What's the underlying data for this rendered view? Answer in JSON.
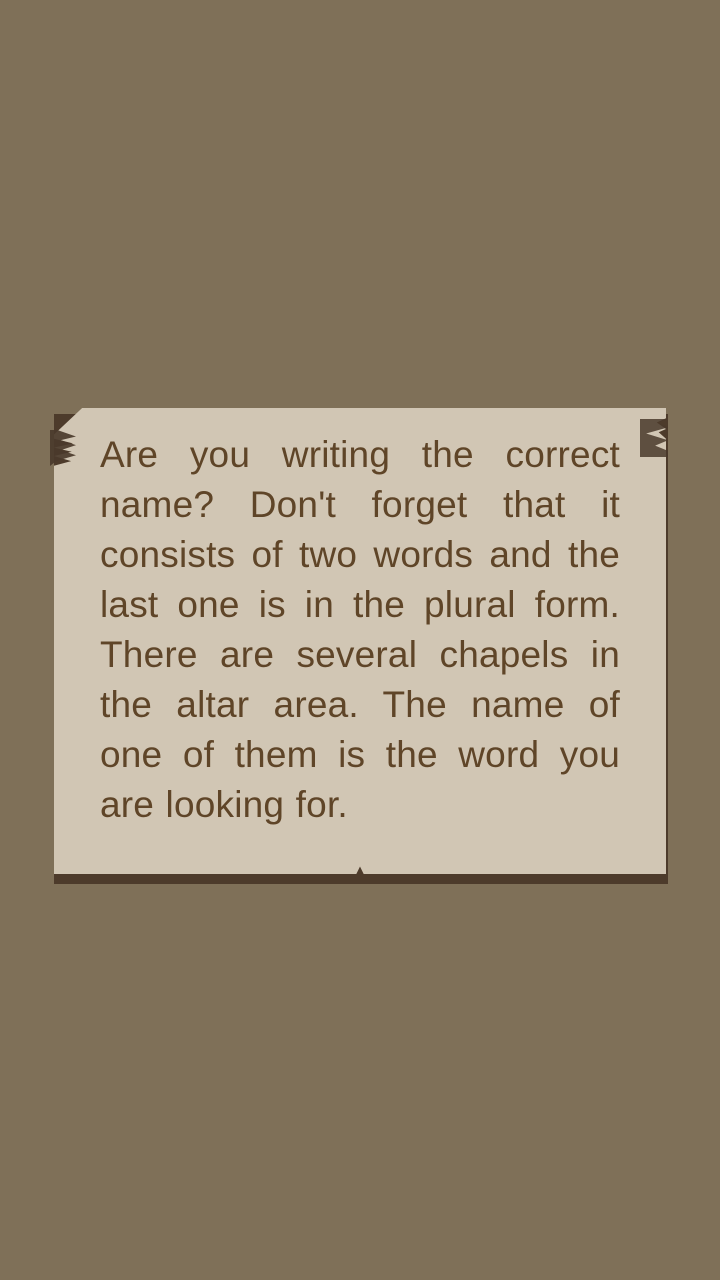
{
  "hint_card": {
    "message": "Are you writing the correct name? Don't forget that it consists of two words and the last one is in the plural form. There are several chapels in the altar area. The name of one of them is the word you are looking for."
  },
  "theme": {
    "background": "#7f7058",
    "paper": "#d1c6b4",
    "text": "#5f4528",
    "shadow": "#4d3b2b"
  }
}
